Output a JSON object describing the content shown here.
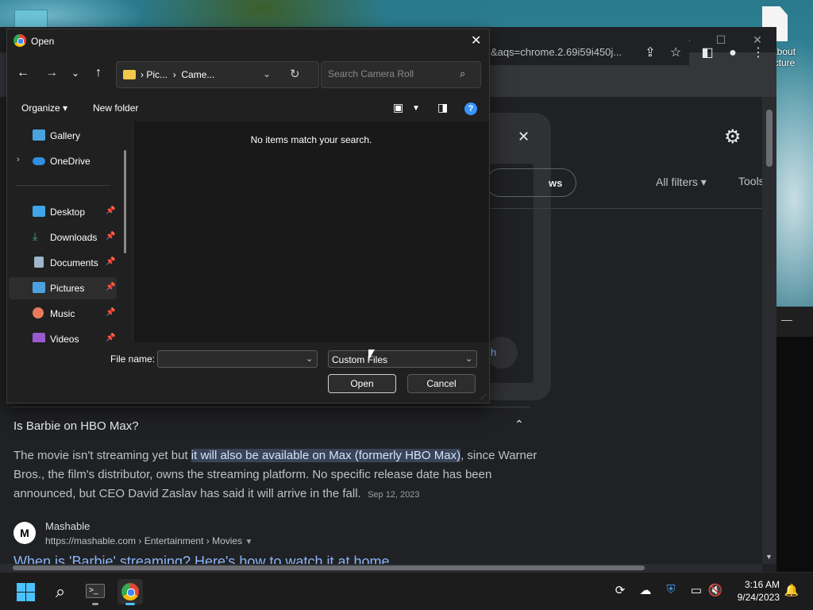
{
  "desktop": {
    "icon_label": "about\nicture"
  },
  "browser": {
    "url_fragment": "&aqs=chrome.2.69i59i450j...",
    "filters_label": "All filters",
    "tools_label": "Tools",
    "news_label": "ws",
    "search_label": "h",
    "faq": {
      "question": "Is Barbie on HBO Max?",
      "answer_before": "The movie isn't streaming yet but ",
      "answer_highlight": "it will also be available on Max (formerly HBO Max)",
      "answer_after": ", since Warner Bros., the film's distributor, owns the streaming platform. No specific release date has been announced, but CEO David Zaslav has said it will arrive in the fall.",
      "date": "Sep 12, 2023"
    },
    "result": {
      "logo": "M",
      "source_name": "Mashable",
      "source_url": "https://mashable.com › Entertainment › Movies",
      "title": "When is 'Barbie' streaming? Here's how to watch it at home"
    }
  },
  "dialog": {
    "title": "Open",
    "breadcrumb": [
      "Pic...",
      "Came..."
    ],
    "search_placeholder": "Search Camera Roll",
    "organize_label": "Organize ▾",
    "new_folder_label": "New folder",
    "empty_message": "No items match your search.",
    "nav_items": [
      {
        "label": "Gallery",
        "icon": "gallery-icon",
        "color": "#4aa3df",
        "pinned": false,
        "expandable": false
      },
      {
        "label": "OneDrive",
        "icon": "onedrive-icon",
        "color": "#2f8fe0",
        "pinned": false,
        "expandable": true
      },
      {
        "label": "Desktop",
        "icon": "desktop-icon",
        "color": "#3fa5e6",
        "pinned": true,
        "expandable": false
      },
      {
        "label": "Downloads",
        "icon": "downloads-icon",
        "color": "#3cb371",
        "pinned": true,
        "expandable": false
      },
      {
        "label": "Documents",
        "icon": "documents-icon",
        "color": "#9fb6cc",
        "pinned": true,
        "expandable": false
      },
      {
        "label": "Pictures",
        "icon": "pictures-icon",
        "color": "#4aa3df",
        "pinned": true,
        "expandable": false,
        "selected": true
      },
      {
        "label": "Music",
        "icon": "music-icon",
        "color": "#e87b5a",
        "pinned": true,
        "expandable": false
      },
      {
        "label": "Videos",
        "icon": "videos-icon",
        "color": "#9b59d0",
        "pinned": true,
        "expandable": false
      }
    ],
    "file_name_label": "File name:",
    "file_name_value": "",
    "file_type_value": "Custom Files",
    "open_label": "Open",
    "cancel_label": "Cancel"
  },
  "taskbar": {
    "time": "3:16 AM",
    "date": "9/24/2023"
  }
}
